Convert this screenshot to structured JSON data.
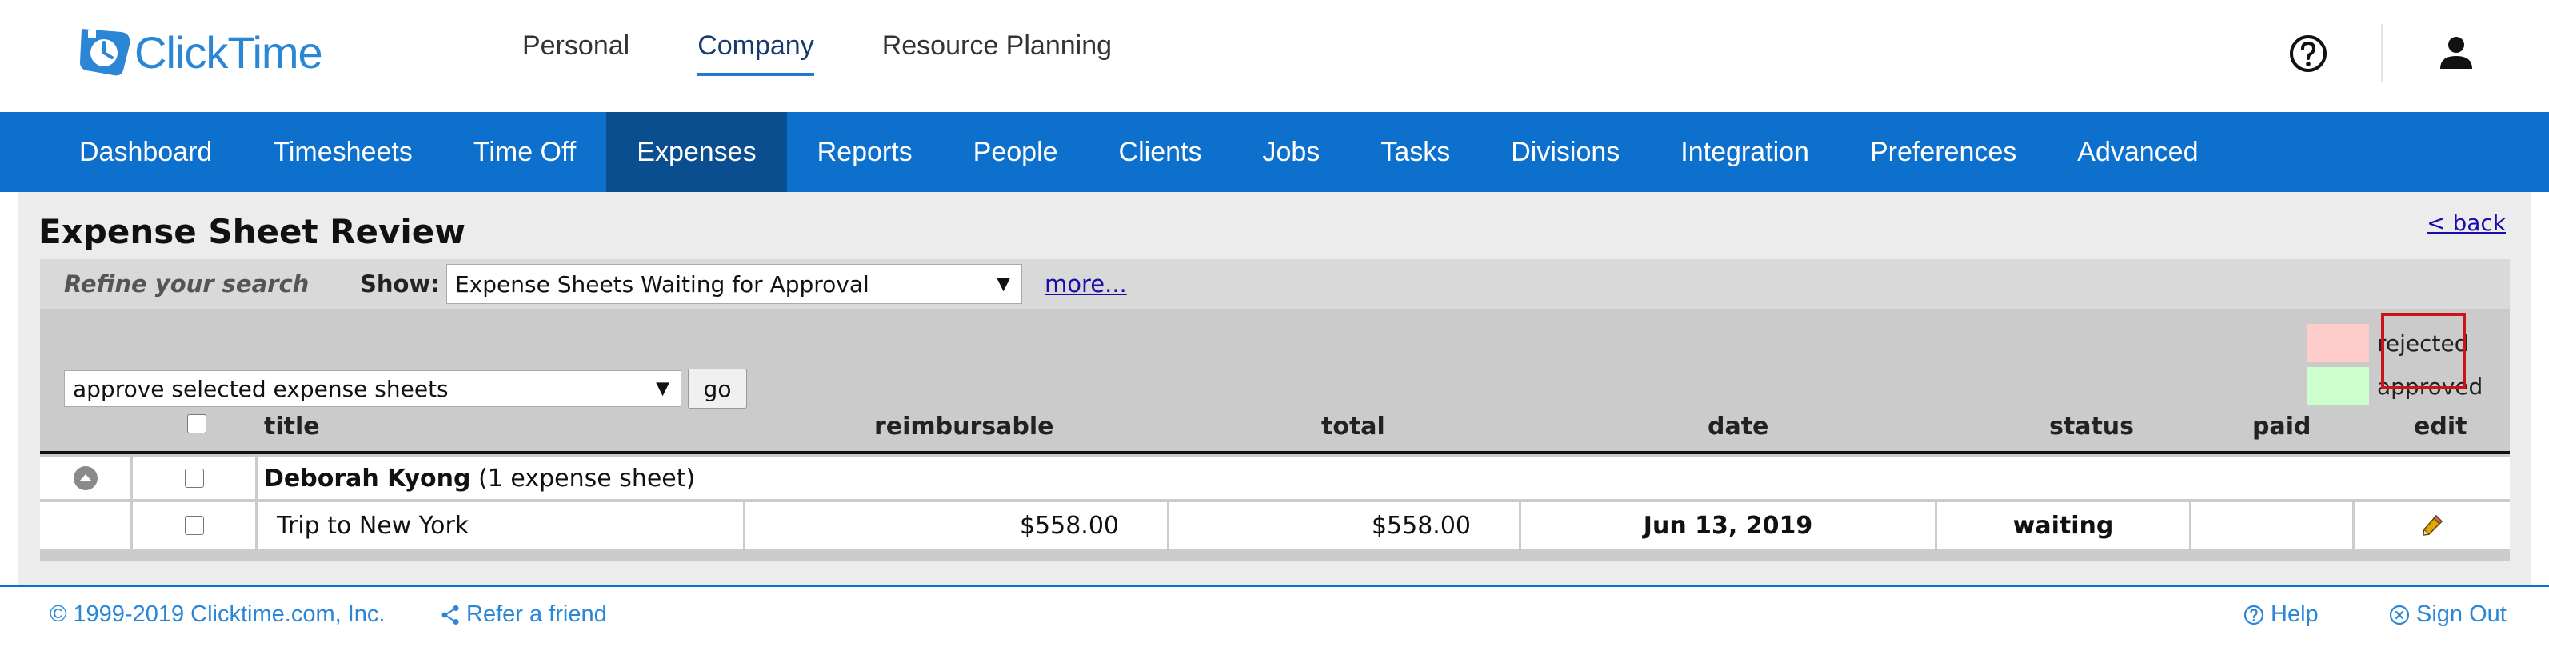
{
  "app": {
    "logo_text": "ClickTime",
    "brand_color": "#2b86d6"
  },
  "primary_nav": {
    "items": [
      {
        "label": "Personal",
        "active": false
      },
      {
        "label": "Company",
        "active": true
      },
      {
        "label": "Resource Planning",
        "active": false
      }
    ]
  },
  "header_icons": {
    "help": "help-circle-icon",
    "user": "user-icon"
  },
  "tabs": [
    {
      "label": "Dashboard",
      "active": false
    },
    {
      "label": "Timesheets",
      "active": false
    },
    {
      "label": "Time Off",
      "active": false
    },
    {
      "label": "Expenses",
      "active": true
    },
    {
      "label": "Reports",
      "active": false
    },
    {
      "label": "People",
      "active": false
    },
    {
      "label": "Clients",
      "active": false
    },
    {
      "label": "Jobs",
      "active": false
    },
    {
      "label": "Tasks",
      "active": false
    },
    {
      "label": "Divisions",
      "active": false
    },
    {
      "label": "Integration",
      "active": false
    },
    {
      "label": "Preferences",
      "active": false
    },
    {
      "label": "Advanced",
      "active": false
    }
  ],
  "page": {
    "title": "Expense Sheet Review",
    "back_link": "< back"
  },
  "refine": {
    "label": "Refine your search",
    "show_label": "Show:",
    "show_value": "Expense Sheets Waiting for Approval",
    "more_link": "more..."
  },
  "bulk_action": {
    "value": "approve selected expense sheets",
    "go_label": "go"
  },
  "legend": [
    {
      "label": "rejected",
      "color": "#ffcccc"
    },
    {
      "label": "approved",
      "color": "#ccffcc"
    }
  ],
  "table": {
    "columns": {
      "title": "title",
      "reimbursable": "reimbursable",
      "total": "total",
      "date": "date",
      "status": "status",
      "paid": "paid",
      "edit": "edit"
    },
    "group": {
      "name": "Deborah Kyong",
      "count_text": "(1 expense sheet)"
    },
    "rows": [
      {
        "title": "Trip to New York",
        "reimbursable": "$558.00",
        "total": "$558.00",
        "date": "Jun 13, 2019",
        "status": "waiting",
        "paid": ""
      }
    ]
  },
  "footer": {
    "copyright": "© 1999-2019 Clicktime.com, Inc.",
    "refer": "Refer a friend",
    "help": "Help",
    "sign_out": "Sign Out"
  }
}
